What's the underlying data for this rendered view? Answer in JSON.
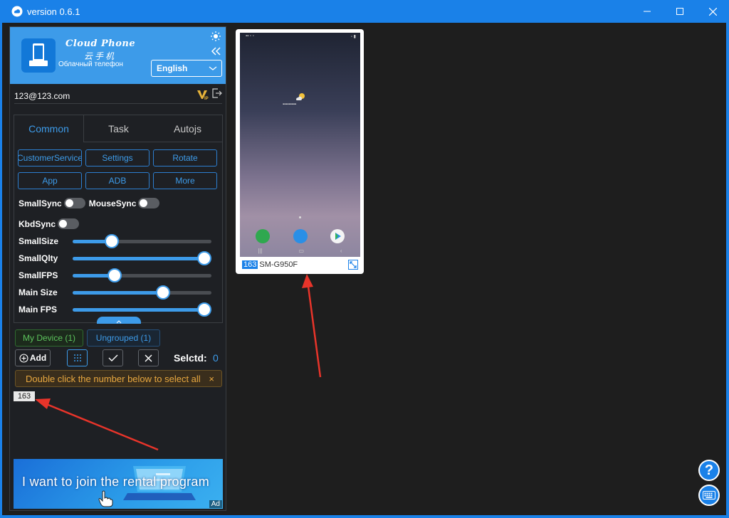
{
  "window": {
    "title": "version 0.6.1"
  },
  "brand": {
    "name_en": "Cloud Phone",
    "name_cn": "云手机",
    "name_ru": "Облачный телефон"
  },
  "language": {
    "selected": "English"
  },
  "user": {
    "email": "123@123.com"
  },
  "tabs": [
    {
      "label": "Common"
    },
    {
      "label": "Task"
    },
    {
      "label": "Autojs"
    }
  ],
  "buttons": [
    {
      "label": "CustomerService"
    },
    {
      "label": "Settings"
    },
    {
      "label": "Rotate"
    },
    {
      "label": "App"
    },
    {
      "label": "ADB"
    },
    {
      "label": "More"
    }
  ],
  "toggles": {
    "small_sync": "SmallSync",
    "mouse_sync": "MouseSync",
    "kbd_sync": "KbdSync"
  },
  "sliders": [
    {
      "label": "SmallSize",
      "value": 0.28
    },
    {
      "label": "SmallQlty",
      "value": 1.0
    },
    {
      "label": "SmallFPS",
      "value": 0.3
    },
    {
      "label": "Main Size",
      "value": 0.65
    },
    {
      "label": "Main FPS",
      "value": 1.0
    }
  ],
  "groups": {
    "my_device": "My Device (1)",
    "ungrouped": "Ungrouped (1)"
  },
  "actions": {
    "add": "Add",
    "selected_label": "Selctd:",
    "selected_count": "0"
  },
  "notice": {
    "text": "Double click the number below to select all",
    "close": "×"
  },
  "device_list": {
    "number": "163"
  },
  "banner": {
    "text": "I want to join the rental program",
    "ad": "Ad"
  },
  "device": {
    "number": "163",
    "model": "SM-G950F"
  },
  "colors": {
    "accent": "#1a81e8",
    "panel_bg": "#1e2024",
    "notice": "#e8a840",
    "annotation": "#e8342a"
  }
}
